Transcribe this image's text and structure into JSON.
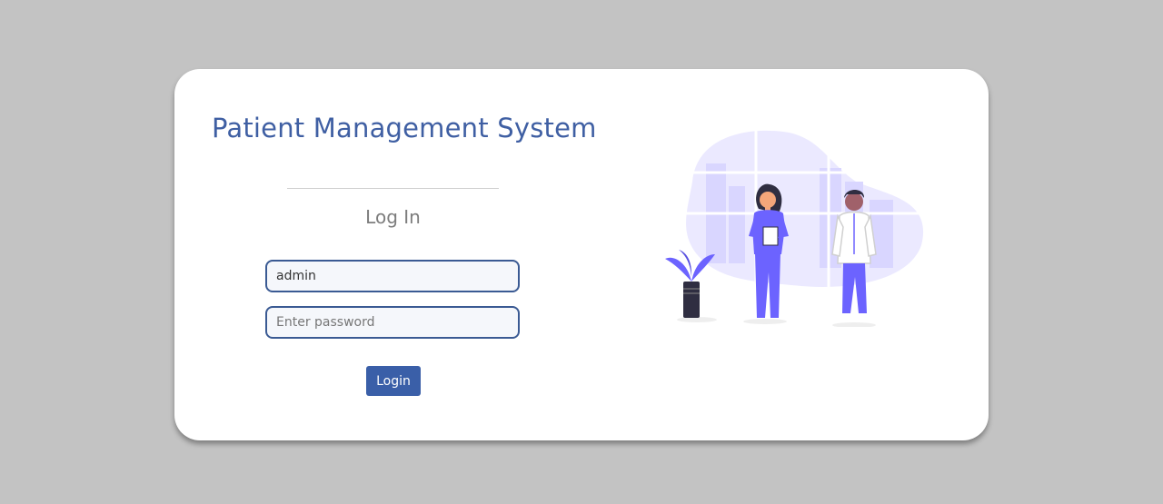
{
  "app": {
    "title": "Patient Management System"
  },
  "login": {
    "heading": "Log In",
    "username_value": "admin",
    "password_placeholder": "Enter password",
    "button_label": "Login"
  },
  "colors": {
    "background": "#c3c3c3",
    "card": "#ffffff",
    "accent": "#3f5fa3",
    "button": "#3a5fa8",
    "illustration": "#6c63ff"
  },
  "illustration": {
    "icon": "doctor-nurse-illustration"
  }
}
